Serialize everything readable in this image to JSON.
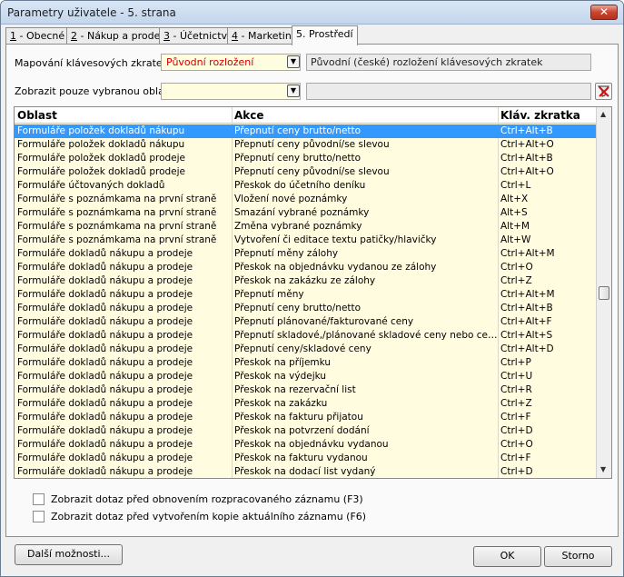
{
  "window": {
    "title": "Parametry uživatele - 5. strana",
    "close_glyph": "✕"
  },
  "tabs": [
    {
      "key": "1",
      "label": " - Obecné"
    },
    {
      "key": "2",
      "label": " - Nákup a prodej"
    },
    {
      "key": "3",
      "label": " - Účetnictví"
    },
    {
      "key": "4",
      "label": " - Marketing"
    },
    {
      "key": "",
      "label": "5. Prostředí"
    }
  ],
  "mapping": {
    "label": "Mapování klávesových zkratek:",
    "value": "Původní rozložení",
    "description": "Původní (české) rozložení klávesových zkratek"
  },
  "area_filter": {
    "label": "Zobrazit pouze vybranou oblast:",
    "value": "",
    "text": ""
  },
  "grid": {
    "columns": [
      "Oblast",
      "Akce",
      "Kláv. zkratka"
    ],
    "rows": [
      [
        "Formuláře položek dokladů nákupu",
        "Přepnutí ceny brutto/netto",
        "Ctrl+Alt+B"
      ],
      [
        "Formuláře položek dokladů nákupu",
        "Přepnutí ceny původní/se slevou",
        "Ctrl+Alt+O"
      ],
      [
        "Formuláře položek dokladů prodeje",
        "Přepnutí ceny brutto/netto",
        "Ctrl+Alt+B"
      ],
      [
        "Formuláře položek dokladů prodeje",
        "Přepnutí ceny původní/se slevou",
        "Ctrl+Alt+O"
      ],
      [
        "Formuláře účtovaných dokladů",
        "Přeskok do účetního deníku",
        "Ctrl+L"
      ],
      [
        "Formuláře s poznámkama na první straně",
        "Vložení nové poznámky",
        "Alt+X"
      ],
      [
        "Formuláře s poznámkama na první straně",
        "Smazání vybrané poznámky",
        "Alt+S"
      ],
      [
        "Formuláře s poznámkama na první straně",
        "Změna vybrané poznámky",
        "Alt+M"
      ],
      [
        "Formuláře s poznámkama na první straně",
        "Vytvoření či editace textu patičky/hlavičky",
        "Alt+W"
      ],
      [
        "Formuláře dokladů nákupu a prodeje",
        "Přepnutí měny zálohy",
        "Ctrl+Alt+M"
      ],
      [
        "Formuláře dokladů nákupu a prodeje",
        "Přeskok na objednávku vydanou ze zálohy",
        "Ctrl+O"
      ],
      [
        "Formuláře dokladů nákupu a prodeje",
        "Přeskok na zakázku ze zálohy",
        "Ctrl+Z"
      ],
      [
        "Formuláře dokladů nákupu a prodeje",
        "Přepnutí měny",
        "Ctrl+Alt+M"
      ],
      [
        "Formuláře dokladů nákupu a prodeje",
        "Přepnutí ceny brutto/netto",
        "Ctrl+Alt+B"
      ],
      [
        "Formuláře dokladů nákupu a prodeje",
        "Přepnutí plánované/fakturované ceny",
        "Ctrl+Alt+F"
      ],
      [
        "Formuláře dokladů nákupu a prodeje",
        "Přepnutí skladové,/plánované skladové ceny nebo ceny s...",
        "Ctrl+Alt+S"
      ],
      [
        "Formuláře dokladů nákupu a prodeje",
        "Přepnutí ceny/skladové ceny",
        "Ctrl+Alt+D"
      ],
      [
        "Formuláře dokladů nákupu a prodeje",
        "Přeskok na příjemku",
        "Ctrl+P"
      ],
      [
        "Formuláře dokladů nákupu a prodeje",
        "Přeskok na výdejku",
        "Ctrl+U"
      ],
      [
        "Formuláře dokladů nákupu a prodeje",
        "Přeskok na rezervační list",
        "Ctrl+R"
      ],
      [
        "Formuláře dokladů nákupu a prodeje",
        "Přeskok na zakázku",
        "Ctrl+Z"
      ],
      [
        "Formuláře dokladů nákupu a prodeje",
        "Přeskok na fakturu přijatou",
        "Ctrl+F"
      ],
      [
        "Formuláře dokladů nákupu a prodeje",
        "Přeskok na potvrzení dodání",
        "Ctrl+D"
      ],
      [
        "Formuláře dokladů nákupu a prodeje",
        "Přeskok na objednávku vydanou",
        "Ctrl+O"
      ],
      [
        "Formuláře dokladů nákupu a prodeje",
        "Přeskok na fakturu vydanou",
        "Ctrl+F"
      ],
      [
        "Formuláře dokladů nákupu a prodeje",
        "Přeskok na dodací list vydaný",
        "Ctrl+D"
      ]
    ],
    "selected_row": 0
  },
  "options": [
    {
      "label": "Zobrazit dotaz před obnovením rozpracovaného záznamu (F3)",
      "checked": false
    },
    {
      "label": "Zobrazit dotaz před vytvořením kopie aktuálního záznamu (F6)",
      "checked": false
    }
  ],
  "buttons": {
    "more": "Další možnosti...",
    "ok": "OK",
    "cancel": "Storno"
  },
  "colors": {
    "selection": "#3399ff",
    "grid_bg": "#fffce0",
    "combo_text": "#cc0000"
  }
}
